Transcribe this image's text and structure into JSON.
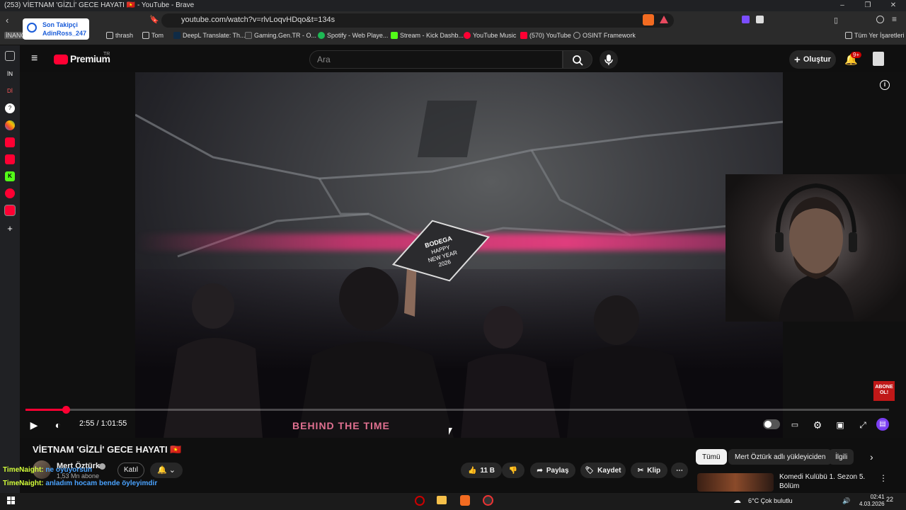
{
  "window": {
    "title": "(253) VİETNAM 'GİZLİ' GECE HAYATI 🇻🇳 - YouTube - Brave"
  },
  "address_bar": {
    "url": "youtube.com/watch?v=rlvLoqvHDqo&t=134s"
  },
  "bookmarks": [
    {
      "label": "İNANÇ",
      "color": "#666666"
    },
    {
      "label": "thrash",
      "color": "#555555"
    },
    {
      "label": "Tom",
      "color": "#555555"
    },
    {
      "label": "DeepL Translate: Th...",
      "color": "#0f2b46"
    },
    {
      "label": "Gaming.Gen.TR - O...",
      "color": "#333333"
    },
    {
      "label": "Spotify - Web Playe...",
      "color": "#1db954"
    },
    {
      "label": "Stream - Kick Dashb...",
      "color": "#53fc18"
    },
    {
      "label": "YouTube Music",
      "color": "#ff0033"
    },
    {
      "label": "(570) YouTube",
      "color": "#ff0033"
    },
    {
      "label": "OSINT Framework",
      "color": "#888888"
    },
    {
      "label": "Tüm Yer İşaretleri",
      "color": "#555555"
    }
  ],
  "browser_sidebar": {
    "items": [
      "İN",
      "Dİ"
    ]
  },
  "header": {
    "logo": "Premium",
    "logo_suffix": "TR",
    "search_placeholder": "Ara",
    "create_label": "Oluştur",
    "notification_badge": "9+"
  },
  "video": {
    "time_current": "2:55",
    "time_total": "1:01:55",
    "time_display": "2:55 / 1:01:55",
    "progress_fraction": 0.047,
    "sign_text": "BODEGA HAPPY NEW YEAR 2026",
    "shirt_text": "BEHIND THE TIME",
    "subscribe_overlay": "ABONE OL!"
  },
  "video_info": {
    "title": "VİETNAM 'GİZLİ' GECE HAYATI 🇻🇳",
    "channel": "Mert Öztürk",
    "subscribers": "1,53 Mn abone",
    "join_label": "Katıl",
    "like_count": "11 B",
    "share_label": "Paylaş",
    "save_label": "Kaydet",
    "clip_label": "Klip"
  },
  "related": {
    "chips": [
      "Tümü",
      "Mert Öztürk adlı yükleyiciden",
      "İlgili"
    ],
    "first_title": "Komedi Kulübü 1. Sezon 5. Bölüm"
  },
  "overlay": {
    "follower_label": "Son Takipçi",
    "follower_name": "AdinRoss_247"
  },
  "chat": [
    {
      "user": "TimeNaight:",
      "message": "ne oyuyorsun"
    },
    {
      "user": "TimeNaight:",
      "message": "anladım hocam bende öyleyimdir"
    }
  ],
  "taskbar": {
    "weather": "6°C  Çok bulutlu",
    "time": "02:41",
    "date": "4.03.2026",
    "notifications": "22"
  },
  "colors": {
    "accent": "#ff0033",
    "background": "#0f0f0f",
    "chat_user": "#d4ff3a",
    "chat_msg": "#4aa3ff"
  }
}
